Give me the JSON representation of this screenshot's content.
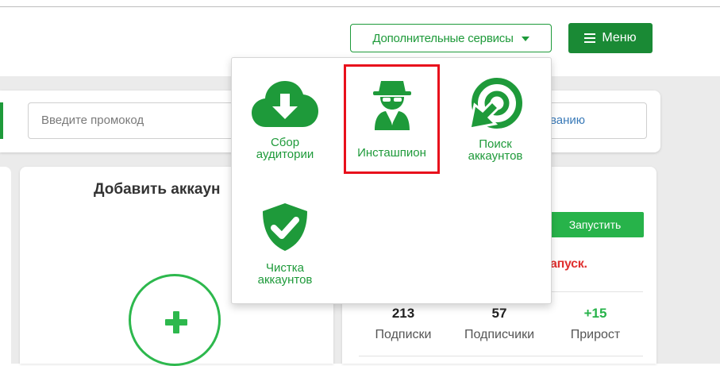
{
  "header": {
    "services_label": "Дополнительные сервисы",
    "menu_label": "Меню"
  },
  "promo": {
    "placeholder": "Введите промокод",
    "right_text": "ванию"
  },
  "add_account": {
    "title": "Добавить аккаун"
  },
  "account_card": {
    "start_label": "Запустить",
    "status_text": "апуск.",
    "stats": [
      {
        "value": "213",
        "label": "Подписки"
      },
      {
        "value": "57",
        "label": "Подписчики"
      },
      {
        "value": "+15",
        "label": "Прирост"
      }
    ]
  },
  "services_menu": {
    "items": [
      {
        "line1": "Сбор",
        "line2": "аудитории",
        "icon": "cloud-download-icon"
      },
      {
        "line1": "Инсташпион",
        "line2": "",
        "icon": "spy-icon",
        "highlighted": true
      },
      {
        "line1": "Поиск",
        "line2": "аккаунтов",
        "icon": "target-cursor-icon"
      },
      {
        "line1": "Чистка",
        "line2": "аккаунтов",
        "icon": "shield-check-icon"
      }
    ]
  },
  "colors": {
    "brand_green": "#1e9a3a",
    "menu_green": "#1a8a35",
    "button_green": "#27b34a",
    "plus_green": "#2db84d",
    "highlight_red": "#e8101c",
    "status_red": "#e0302f"
  }
}
